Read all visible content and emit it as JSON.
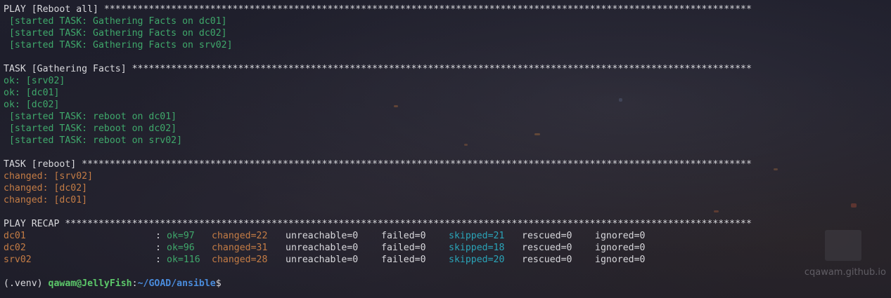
{
  "lines": {
    "play_header": "PLAY [Reboot all] ********************************************************************************************************************",
    "started_gf_1": " [started TASK: Gathering Facts on dc01]",
    "started_gf_2": " [started TASK: Gathering Facts on dc02]",
    "started_gf_3": " [started TASK: Gathering Facts on srv02]",
    "task_gf_header": "TASK [Gathering Facts] ***************************************************************************************************************",
    "ok_1": "ok: [srv02]",
    "ok_2": "ok: [dc01]",
    "ok_3": "ok: [dc02]",
    "started_rb_1": " [started TASK: reboot on dc01]",
    "started_rb_2": " [started TASK: reboot on dc02]",
    "started_rb_3": " [started TASK: reboot on srv02]",
    "task_reboot_header": "TASK [reboot] ************************************************************************************************************************",
    "changed_1": "changed: [srv02]",
    "changed_2": "changed: [dc02]",
    "changed_3": "changed: [dc01]",
    "recap_header": "PLAY RECAP ***************************************************************************************************************************"
  },
  "recap": [
    {
      "host": "dc01",
      "colon": ":",
      "ok": "ok=97",
      "changed": "changed=22",
      "unreachable": "unreachable=0",
      "failed": "failed=0",
      "skipped": "skipped=21",
      "rescued": "rescued=0",
      "ignored": "ignored=0"
    },
    {
      "host": "dc02",
      "colon": ":",
      "ok": "ok=96",
      "changed": "changed=31",
      "unreachable": "unreachable=0",
      "failed": "failed=0",
      "skipped": "skipped=18",
      "rescued": "rescued=0",
      "ignored": "ignored=0"
    },
    {
      "host": "srv02",
      "colon": ":",
      "ok": "ok=116",
      "changed": "changed=28",
      "unreachable": "unreachable=0",
      "failed": "failed=0",
      "skipped": "skipped=20",
      "rescued": "rescued=0",
      "ignored": "ignored=0"
    }
  ],
  "prompt": {
    "venv": "(.venv) ",
    "user_host": "qawam@JellyFish",
    "sep": ":",
    "path": "~/GOAD/ansible",
    "symbol": "$"
  },
  "watermark": "cqawam.github.io",
  "colors": {
    "background": "#1c1c28",
    "text": "#d8d8dc",
    "ok_green": "#3fa86b",
    "changed_orange": "#c47c45",
    "skipped_cyan": "#2aa4b8",
    "prompt_user": "#5cc86a",
    "prompt_path": "#4a8cdc"
  }
}
